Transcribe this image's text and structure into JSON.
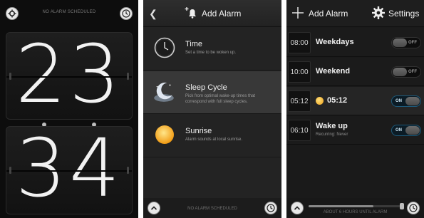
{
  "clock_screen": {
    "status": "NO ALARM SCHEDULED",
    "hours": "23",
    "minutes": "34",
    "icons": [
      "settings-icon",
      "clock-icon"
    ]
  },
  "add_alarm_screen": {
    "title": "Add Alarm",
    "back_icon": "chevron-left-icon",
    "items": [
      {
        "title": "Time",
        "description": "Set a time to be woken up.",
        "icon": "clock-face-icon"
      },
      {
        "title": "Sleep Cycle",
        "description": "Pick from optimal wake-up times that correspond with full sleep cycles.",
        "icon": "moon-icon"
      },
      {
        "title": "Sunrise",
        "description": "Alarm sounds at local sunrise.",
        "icon": "sun-icon"
      }
    ],
    "footer": "NO ALARM SCHEDULED"
  },
  "alarm_list_screen": {
    "add_label": "Add Alarm",
    "settings_label": "Settings",
    "alarms": [
      {
        "time": "08:00",
        "name": "Weekdays",
        "toggle": "OFF"
      },
      {
        "time": "10:00",
        "name": "Weekend",
        "toggle": "OFF"
      },
      {
        "time": "05:12",
        "name": "05:12",
        "toggle": "ON"
      },
      {
        "time": "06:10",
        "name": "Wake up",
        "subtitle": "Recurring: Never",
        "toggle": "ON"
      }
    ],
    "footer": "ABOUT 6 HOURS UNTIL ALARM",
    "progress_fraction": 0.7
  },
  "colors": {
    "background": "#141414",
    "toggle_on_border": "#1e5a7a",
    "sun": "#f0a21c"
  }
}
